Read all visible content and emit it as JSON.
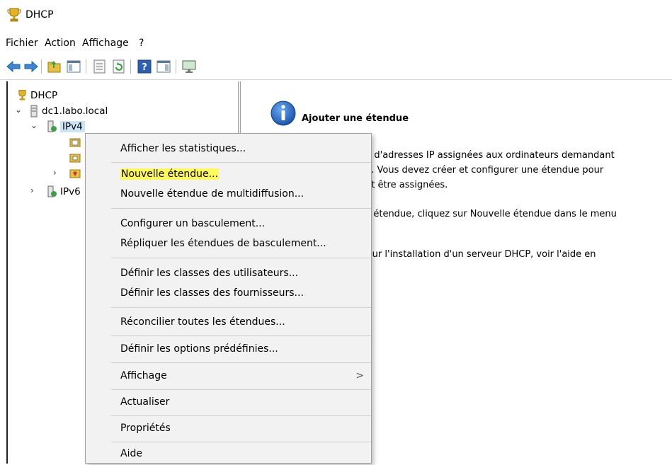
{
  "window": {
    "title": "DHCP",
    "icon": "dhcp-trophy-icon"
  },
  "menu": [
    "Fichier",
    "Action",
    "Affichage",
    "?"
  ],
  "toolbar": {
    "buttons": [
      "back-arrow-icon",
      "forward-arrow-icon",
      "up-folder-icon",
      "show-hide-tree-icon",
      "properties-icon",
      "refresh-icon",
      "help-icon",
      "show-action-pane-icon",
      "monitor-icon"
    ]
  },
  "tree": {
    "root": "DHCP",
    "server": "dc1.labo.local",
    "ipv4": "IPv4",
    "ipv6": "IPv6"
  },
  "content": {
    "title": "Ajouter une étendue",
    "line1": "ge d'adresses IP assignées aux ordinateurs demandant",
    "line2": "ue. Vous devez créer et configurer une étendue pour",
    "line3": "ent être assignées.",
    "line4": "lle étendue, cliquez sur Nouvelle étendue dans le menu",
    "line5": "s sur l'installation d'un serveur DHCP, voir l'aide en"
  },
  "context_menu": {
    "items": [
      "Afficher les statistiques...",
      "Nouvelle étendue...",
      "Nouvelle étendue de multidiffusion...",
      "Configurer un basculement...",
      "Répliquer les étendues de basculement...",
      "Définir les classes des utilisateurs...",
      "Définir les classes des fournisseurs...",
      "Réconcilier toutes les étendues...",
      "Définir les options prédéfinies...",
      "Affichage",
      "Actualiser",
      "Propriétés",
      "Aide"
    ],
    "submenu_arrow": ">",
    "highlight_color": "#fff95a"
  }
}
